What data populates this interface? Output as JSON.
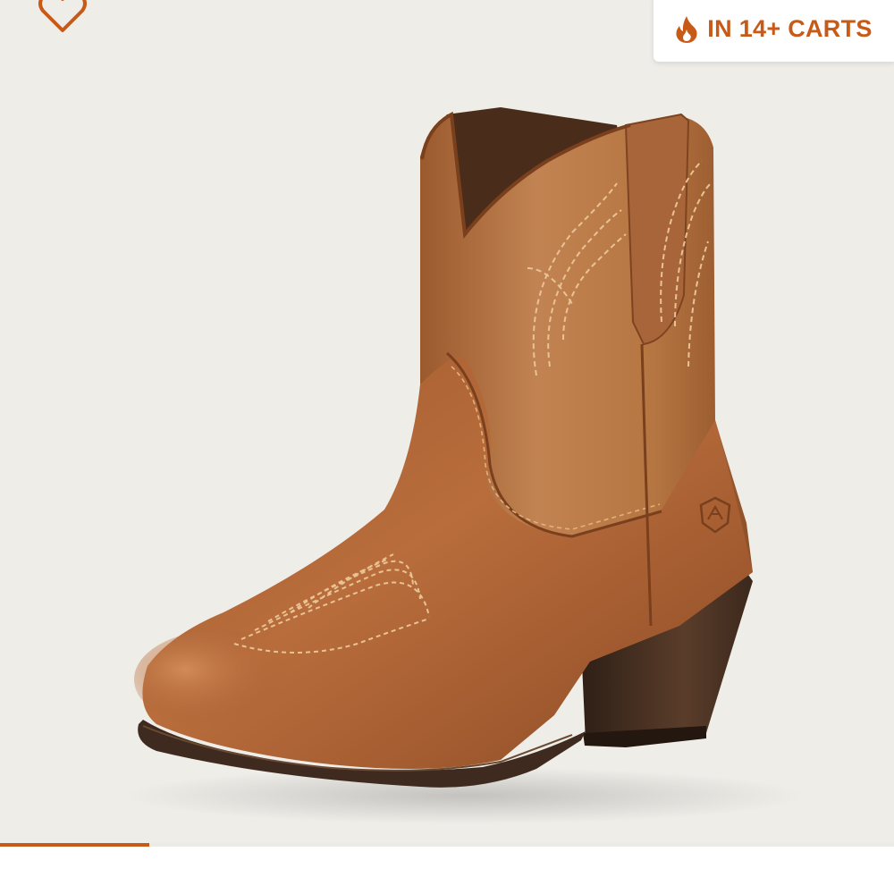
{
  "badge": {
    "text": "IN 14+ CARTS",
    "icon": "flame-icon"
  },
  "favorite": {
    "icon": "heart-outline-icon"
  },
  "product_image": {
    "subject": "brown-leather-western-ankle-boot"
  },
  "gallery": {
    "progress": 0.167
  },
  "colors": {
    "accent": "#c85a17",
    "background": "#efede8",
    "leather": "#b0683a",
    "sole": "#3e2a1e"
  }
}
